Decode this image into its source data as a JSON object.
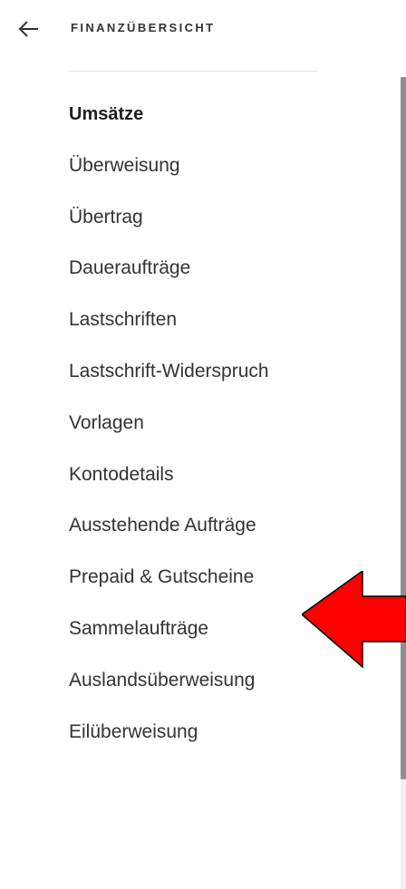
{
  "header": {
    "back_icon": "arrow-left-icon",
    "title": "FINANZÜBERSICHT"
  },
  "menu": {
    "items": [
      {
        "label": "Umsätze",
        "active": true
      },
      {
        "label": "Überweisung"
      },
      {
        "label": "Übertrag"
      },
      {
        "label": "Daueraufträge"
      },
      {
        "label": "Lastschriften"
      },
      {
        "label": "Lastschrift-Widerspruch"
      },
      {
        "label": "Vorlagen"
      },
      {
        "label": "Kontodetails"
      },
      {
        "label": "Ausstehende Aufträge"
      },
      {
        "label": "Prepaid & Gutscheine"
      },
      {
        "label": "Sammelaufträge"
      },
      {
        "label": "Auslandsüberweisung"
      },
      {
        "label": "Eilüberweisung"
      }
    ]
  },
  "annotation": {
    "icon": "red-arrow-icon",
    "color": "#ff0000",
    "points_to": "Ausstehende Aufträge"
  },
  "colors": {
    "text": "#333333",
    "divider": "#e6e6e6",
    "scrollbar_thumb": "#8f8f8f"
  }
}
